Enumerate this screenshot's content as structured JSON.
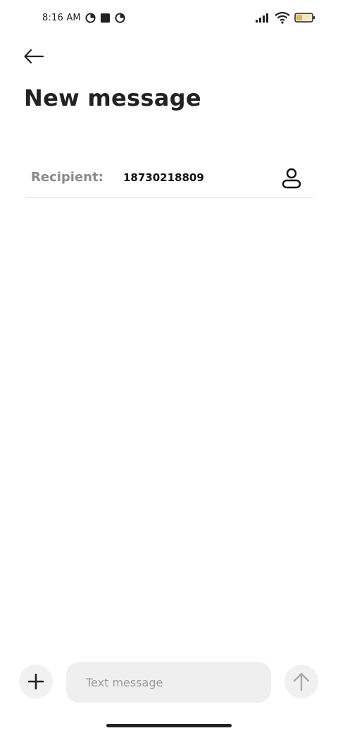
{
  "status_bar": {
    "time": "8:16 AM",
    "icons": [
      "app-circle-icon",
      "app-square-icon",
      "app-circle-icon",
      "signal-icon",
      "wifi-icon",
      "battery-icon"
    ]
  },
  "header": {
    "back_icon": "back-arrow-icon",
    "title": "New message"
  },
  "recipient": {
    "label": "Recipient:",
    "value": "18730218809",
    "contact_icon": "contact-person-icon"
  },
  "composer": {
    "add_icon": "plus-icon",
    "placeholder": "Text message",
    "value": "",
    "send_icon": "send-arrow-up-icon"
  },
  "colors": {
    "title": "#222222",
    "label": "#8a8a8a",
    "field_bg": "#efefef",
    "button_bg": "#f1f1f1",
    "divider": "#e3e3e3"
  }
}
